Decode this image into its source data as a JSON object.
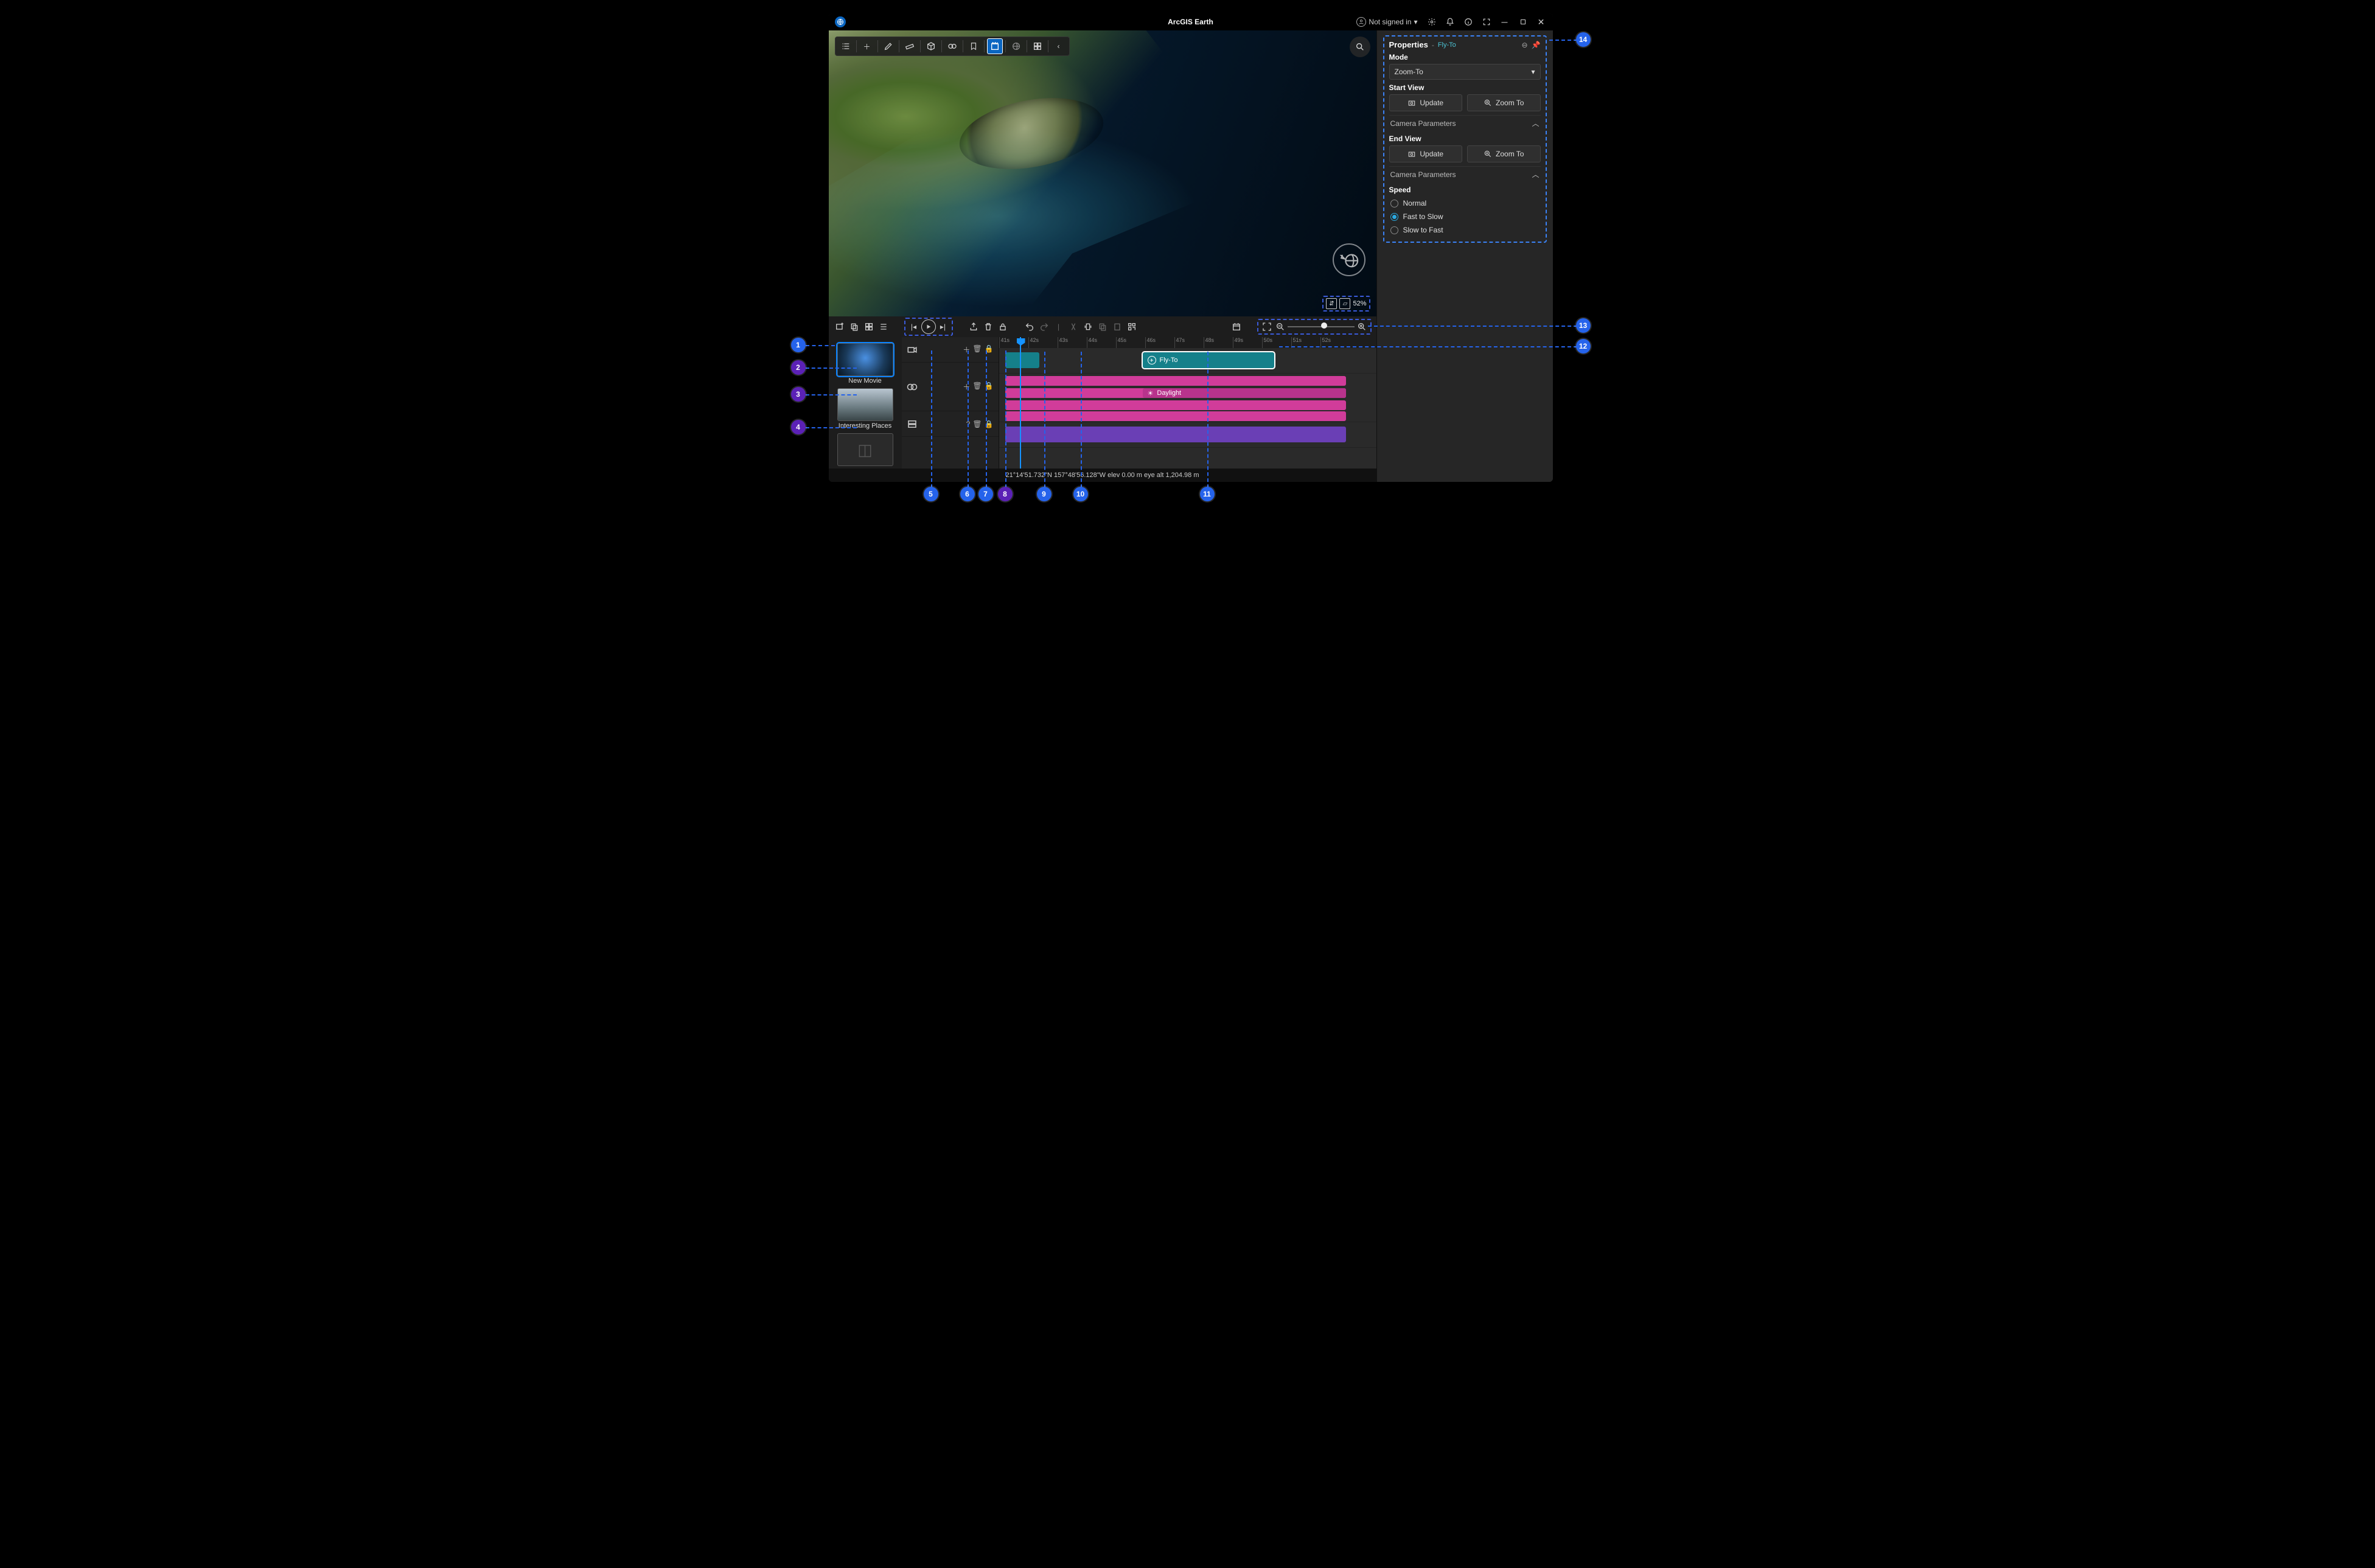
{
  "app": {
    "title": "ArcGIS Earth"
  },
  "account": {
    "label": "Not signed in"
  },
  "toolbar": {
    "items": [
      "list",
      "plus",
      "pencil",
      "ruler",
      "cube",
      "layers",
      "bookmark",
      "movie",
      "globe",
      "grid",
      "chevron"
    ],
    "active_index": 7
  },
  "corner": {
    "percent": "52%"
  },
  "status": {
    "text": "21°14'51.732\"N 157°48'56.128\"W  elev 0.00 m   eye alt 1,204.98 m"
  },
  "movielist_header_icons": [
    "add-movie",
    "grid-movies",
    "view-grid",
    "list"
  ],
  "movies": [
    {
      "name": "New Movie",
      "thumb": "glb",
      "selected": true
    },
    {
      "name": "Interesting Places",
      "thumb": "mtn",
      "selected": false
    },
    {
      "name": "",
      "thumb": "cube",
      "selected": false
    }
  ],
  "ruler_ticks": [
    "41s",
    "42s",
    "43s",
    "44s",
    "45s",
    "46s",
    "47s",
    "48s",
    "49s",
    "50s",
    "51s",
    "52s"
  ],
  "segments": {
    "flyto_label": "Fly-To",
    "daylight_label": "Daylight"
  },
  "properties": {
    "panel_title": "Properties",
    "panel_sub": "Fly-To",
    "mode_label": "Mode",
    "mode_value": "Zoom-To",
    "startview_label": "Start View",
    "endview_label": "End View",
    "update_label": "Update",
    "zoomto_label": "Zoom To",
    "camparams_label": "Camera Parameters",
    "speed_label": "Speed",
    "speed_options": [
      "Normal",
      "Fast to Slow",
      "Slow to Fast"
    ],
    "speed_selected": 1
  },
  "callouts": {
    "1": "1",
    "2": "2",
    "3": "3",
    "4": "4",
    "5": "5",
    "6": "6",
    "7": "7",
    "8": "8",
    "9": "9",
    "10": "10",
    "11": "11",
    "12": "12",
    "13": "13",
    "14": "14"
  }
}
